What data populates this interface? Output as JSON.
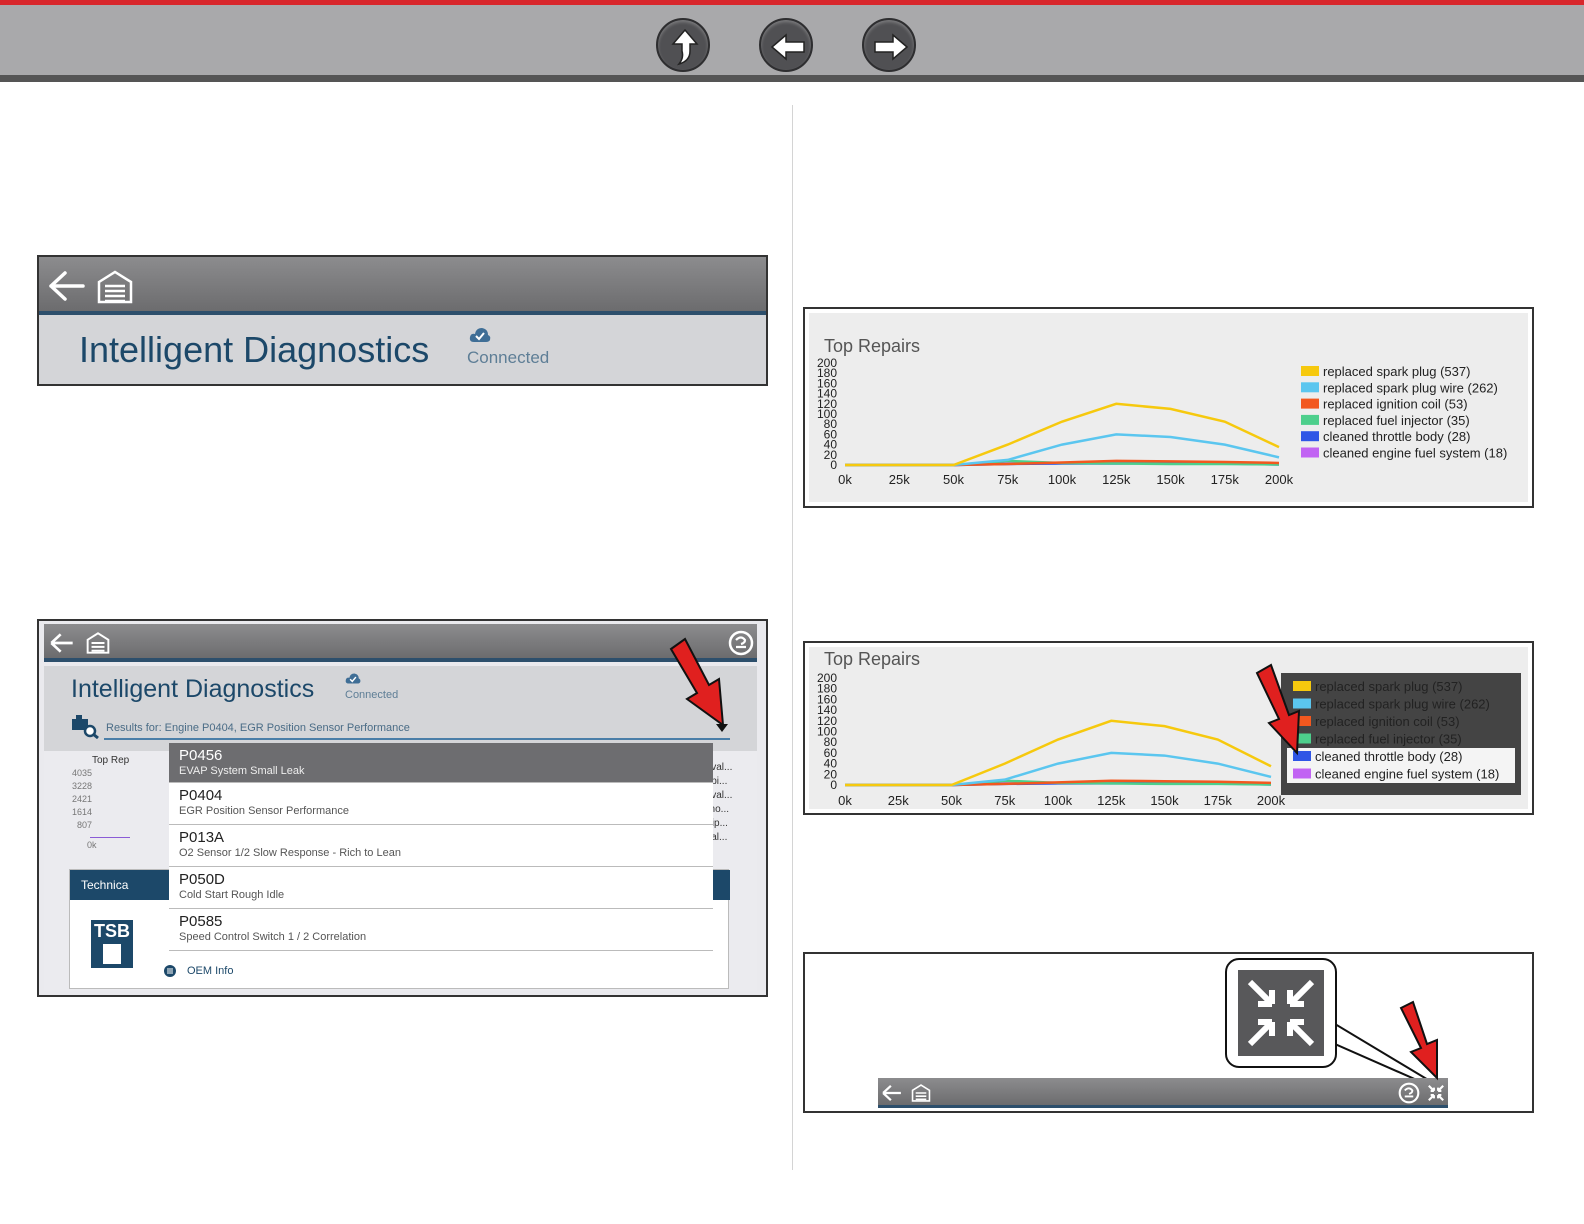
{
  "colors": {
    "accent_red": "#d8262b",
    "title_blue": "#1c4869",
    "series": [
      "#f6c90e",
      "#5bc6ef",
      "#f2581f",
      "#4dcf8c",
      "#2f56e6",
      "#c163f3"
    ]
  },
  "nav": {
    "icons": [
      "up-arrow-icon",
      "back-arrow-icon",
      "forward-arrow-icon"
    ]
  },
  "panel1": {
    "title": "Intelligent Diagnostics",
    "status": "Connected"
  },
  "panel2": {
    "title": "Intelligent Diagnostics",
    "status": "Connected",
    "results_label": "Results for:  Engine P0404, EGR Position Sensor Performance",
    "chart_label": "Top Rep",
    "y_ticks": [
      "4035",
      "3228",
      "2421",
      "1614",
      "807"
    ],
    "x_tick": "0k",
    "side_items": [
      "culation val...",
      "culation pi...",
      "culation val...",
      "control mo...",
      "ulation pip...",
      "ulation val..."
    ],
    "dropdown": [
      {
        "code": "P0456",
        "desc": "EVAP System Small Leak"
      },
      {
        "code": "P0404",
        "desc": "EGR Position Sensor Performance"
      },
      {
        "code": "P013A",
        "desc": "O2 Sensor 1/2 Slow Response - Rich to Lean"
      },
      {
        "code": "P050D",
        "desc": "Cold Start Rough Idle"
      },
      {
        "code": "P0585",
        "desc": "Speed Control Switch 1 / 2 Correlation"
      }
    ],
    "card_title": "Technica",
    "tsb": "TSB",
    "oem": "OEM Info"
  },
  "chart_data": [
    {
      "type": "line",
      "title": "Top Repairs",
      "categories": [
        "0k",
        "25k",
        "50k",
        "75k",
        "100k",
        "125k",
        "150k",
        "175k",
        "200k"
      ],
      "y_ticks": [
        "200",
        "180",
        "160",
        "140",
        "120",
        "100",
        "80",
        "60",
        "40",
        "20",
        "0"
      ],
      "ylim": [
        0,
        200
      ],
      "series": [
        {
          "name": "replaced spark plug (537)",
          "values": [
            0,
            0,
            0,
            40,
            85,
            120,
            110,
            85,
            35
          ]
        },
        {
          "name": "replaced spark plug wire (262)",
          "values": [
            0,
            0,
            0,
            10,
            40,
            60,
            55,
            40,
            15
          ]
        },
        {
          "name": "replaced ignition coil (53)",
          "values": [
            0,
            0,
            0,
            2,
            5,
            8,
            7,
            6,
            4
          ]
        },
        {
          "name": "replaced fuel injector (35)",
          "values": [
            0,
            0,
            0,
            8,
            4,
            3,
            2,
            2,
            1
          ]
        },
        {
          "name": "cleaned throttle body (28)",
          "values": [
            0,
            0,
            0,
            2,
            3,
            3,
            4,
            3,
            1
          ]
        },
        {
          "name": "cleaned engine fuel system (18)",
          "values": [
            0,
            0,
            0,
            3,
            4,
            4,
            3,
            3,
            2
          ]
        }
      ],
      "legend_position": "right"
    },
    {
      "type": "line",
      "title": "Top Repairs",
      "categories": [
        "0k",
        "25k",
        "50k",
        "75k",
        "100k",
        "125k",
        "150k",
        "175k",
        "200k"
      ],
      "y_ticks": [
        "200",
        "180",
        "160",
        "140",
        "120",
        "100",
        "80",
        "60",
        "40",
        "20",
        "0"
      ],
      "ylim": [
        0,
        200
      ],
      "series": [
        {
          "name": "replaced spark plug (537)",
          "values": [
            0,
            0,
            0,
            40,
            85,
            120,
            110,
            85,
            35
          ]
        },
        {
          "name": "replaced spark plug wire (262)",
          "values": [
            0,
            0,
            0,
            10,
            40,
            60,
            55,
            40,
            15
          ]
        },
        {
          "name": "replaced ignition coil (53)",
          "values": [
            0,
            0,
            0,
            2,
            5,
            8,
            7,
            6,
            4
          ]
        },
        {
          "name": "replaced fuel injector (35)",
          "values": [
            0,
            0,
            0,
            8,
            4,
            3,
            2,
            2,
            1
          ]
        },
        {
          "name": "cleaned throttle body (28)",
          "values": [
            0,
            0,
            0,
            2,
            3,
            3,
            4,
            3,
            1
          ]
        },
        {
          "name": "cleaned engine fuel system (18)",
          "values": [
            0,
            0,
            0,
            3,
            4,
            4,
            3,
            3,
            2
          ]
        }
      ],
      "legend_position": "right",
      "highlighted": [
        4,
        5
      ]
    }
  ]
}
